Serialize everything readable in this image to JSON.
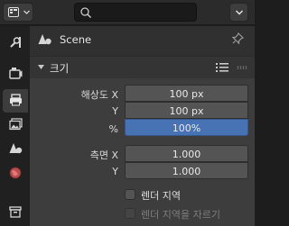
{
  "header": {
    "editor_type_icon": "properties-editor-icon",
    "search_value": "",
    "search_placeholder": "",
    "dropdown_icon": "chevron-down-icon"
  },
  "tabs": [
    {
      "name": "tool",
      "icon": "wrench-screwdriver-icon",
      "active": false
    },
    {
      "name": "render",
      "icon": "camera-back-icon",
      "active": false
    },
    {
      "name": "output",
      "icon": "printer-icon",
      "active": true
    },
    {
      "name": "view-layer",
      "icon": "image-stack-icon",
      "active": false
    },
    {
      "name": "scene",
      "icon": "cone-sphere-icon",
      "active": false
    },
    {
      "name": "world",
      "icon": "globe-icon",
      "active": false
    },
    {
      "name": "collection",
      "icon": "box-icon",
      "active": false
    }
  ],
  "breadcrumb": {
    "label": "Scene",
    "icon": "scene-icon",
    "pin_icon": "pin-icon"
  },
  "panel": {
    "title": "크기",
    "resolution": {
      "label": "해상도 X",
      "y_label": "Y",
      "percent_label": "%",
      "x_value": "100 px",
      "y_value": "100 px",
      "percent_value": "100%"
    },
    "aspect": {
      "label": "측면 X",
      "y_label": "Y",
      "x_value": "1.000",
      "y_value": "1.000"
    },
    "render_region": {
      "label": "렌더 지역",
      "checked": false
    },
    "crop_region": {
      "label": "렌더 지역을 자르기",
      "checked": false,
      "disabled": true
    }
  },
  "colors": {
    "accent": "#4772b3",
    "panel_bg": "#3d3d3d",
    "field_bg": "#545454"
  }
}
